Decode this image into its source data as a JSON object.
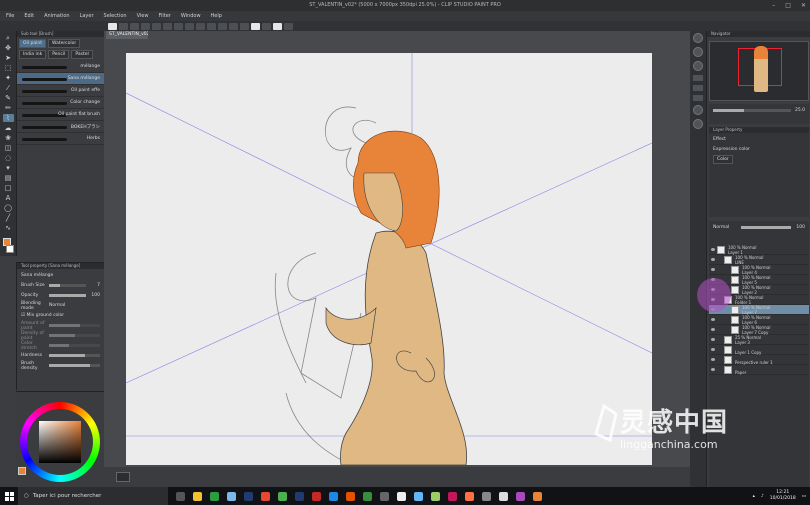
{
  "window": {
    "title": "ST_VALENTIN_v02* (5000 x 7000px 350dpi 25.0%) - CLIP STUDIO PAINT PRO",
    "controls": [
      "–",
      "□",
      "✕"
    ]
  },
  "menu": [
    "File",
    "Edit",
    "Animation",
    "Layer",
    "Selection",
    "View",
    "Filter",
    "Window",
    "Help"
  ],
  "doc_tab": "ST_VALENTIN_v02*",
  "subtool": {
    "header": "Sub tool [Brush]",
    "tabs": [
      "Oil paint",
      "Watercolor",
      "India ink",
      "Pencil",
      "Pastel"
    ],
    "brushes": [
      "mélange",
      "Sana mélange",
      "Oil paint effe",
      "Color change",
      "Oil paint flat brush",
      "BOKEHブラシ",
      "Herbs"
    ]
  },
  "tool_property": {
    "header": "Tool property [Sana mélange]",
    "name": "Sana mélange",
    "brush_size_label": "Brush Size",
    "brush_size": "7",
    "opacity_label": "Opacity",
    "opacity": "100",
    "blending_label": "Blending mode",
    "blending": "Normal",
    "mix_label": "Mix ground color",
    "amount_label": "Amount of paint",
    "density_label": "Density of paint",
    "stretch_label": "Color stretch",
    "hardness_label": "Hardness",
    "brush_density_label": "Brush density"
  },
  "navigator": {
    "title": "Navigator",
    "zoom": "25.0"
  },
  "effect": {
    "tabs": [
      "Layer Property"
    ],
    "title": "Effect",
    "expression_label": "Expression color",
    "expression_value": "Color"
  },
  "layer_panel": {
    "blend": "Normal",
    "opacity": "100",
    "layers": [
      {
        "l1": "100 % Normal",
        "l2": "Layer 1",
        "indent": 0
      },
      {
        "l1": "100 % Normal",
        "l2": "LINE",
        "indent": 1
      },
      {
        "l1": "100 % Normal",
        "l2": "Layer 4",
        "indent": 2
      },
      {
        "l1": "100 % Normal",
        "l2": "Layer 5",
        "indent": 2
      },
      {
        "l1": "100 % Normal",
        "l2": "Layer 2",
        "indent": 2
      },
      {
        "l1": "100 % Normal",
        "l2": "Folder 1",
        "indent": 1
      },
      {
        "l1": "100 % Normal",
        "l2": "Layer 7",
        "indent": 2,
        "selected": true
      },
      {
        "l1": "100 % Normal",
        "l2": "Layer 6",
        "indent": 2
      },
      {
        "l1": "100 % Normal",
        "l2": "Layer 7 Copy",
        "indent": 2
      },
      {
        "l1": "25 % Normal",
        "l2": "Layer 3",
        "indent": 1
      },
      {
        "l1": "",
        "l2": "Layer 1 Copy",
        "indent": 1
      },
      {
        "l1": "",
        "l2": "Perspective ruler 1",
        "indent": 1
      },
      {
        "l1": "",
        "l2": "Paper",
        "indent": 1
      }
    ]
  },
  "taskbar": {
    "search_placeholder": "Taper ici pour rechercher",
    "time": "12:21",
    "date": "10/01/2018"
  },
  "watermark": {
    "cn": "灵感中国",
    "en": "lingganchina.com"
  },
  "colors": {
    "hair": "#e8833a",
    "skin": "#e0b883",
    "accent": "#4f6f8a",
    "selected_layer": "#6f8ea8"
  }
}
